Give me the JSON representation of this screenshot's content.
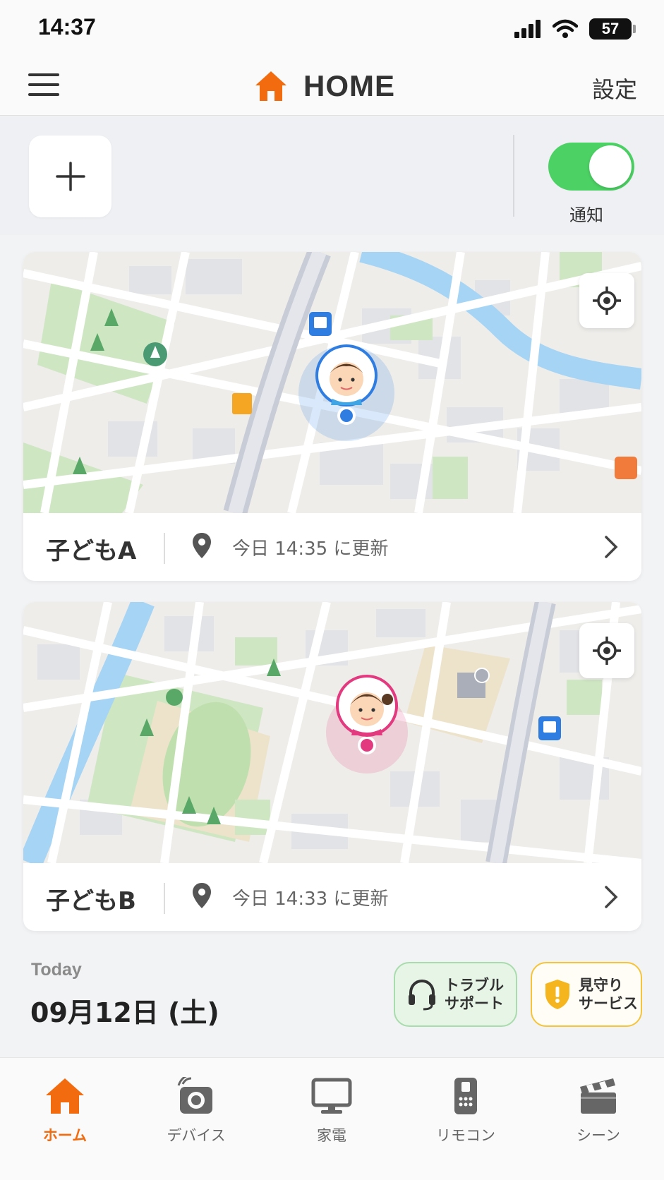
{
  "status_bar": {
    "time": "14:37",
    "battery": "57"
  },
  "header": {
    "title": "HOME",
    "settings_label": "設定"
  },
  "toolbar": {
    "notification_label": "通知",
    "notification_on": true
  },
  "children": [
    {
      "name": "子どもA",
      "update_text": "今日 14:35 に更新",
      "accent": "#2f7de1"
    },
    {
      "name": "子どもB",
      "update_text": "今日 14:33 に更新",
      "accent": "#e2397f"
    }
  ],
  "today": {
    "label": "Today",
    "date": "09月12日 (土)"
  },
  "quick_actions": {
    "trouble_line1": "トラブル",
    "trouble_line2": "サポート",
    "watch_line1": "見守り",
    "watch_line2": "サービス"
  },
  "nav": {
    "home": "ホーム",
    "devices": "デバイス",
    "appliances": "家電",
    "remote": "リモコン",
    "scene": "シーン"
  },
  "colors": {
    "brand": "#f26b0f",
    "toggle_on": "#4cd164",
    "water": "#a6d4f5",
    "park": "#cfe6c3"
  },
  "icons": [
    "menu-icon",
    "house-icon",
    "plus-icon",
    "locate-icon",
    "pin-icon",
    "chevron-right-icon",
    "headset-icon",
    "shield-icon",
    "camera-icon",
    "monitor-icon",
    "remote-icon",
    "clapper-icon"
  ]
}
